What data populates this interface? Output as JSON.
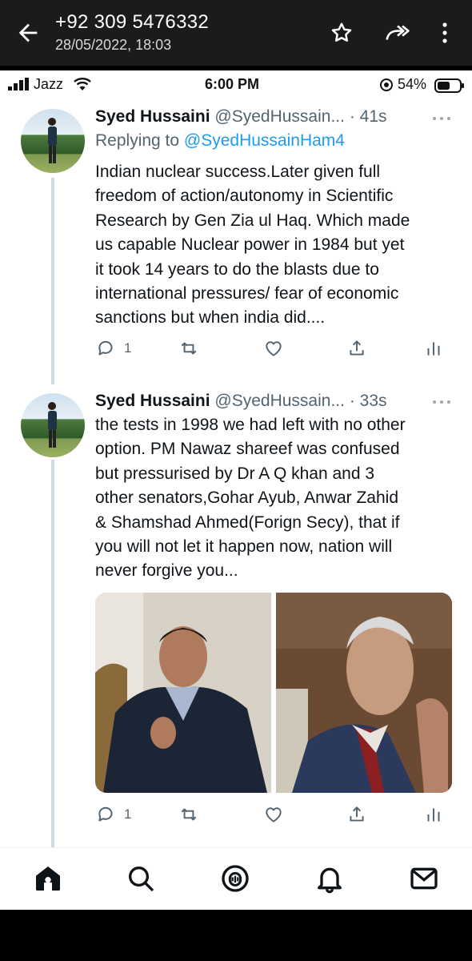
{
  "viewer": {
    "title": "+92 309 5476332",
    "subtitle": "28/05/2022, 18:03",
    "icons": [
      "back-arrow-icon",
      "star-icon",
      "forward-icon",
      "more-vert-icon"
    ]
  },
  "statusbar": {
    "carrier": "Jazz",
    "time": "6:00 PM",
    "battery": "54%"
  },
  "tweets": [
    {
      "name": "Syed Hussaini",
      "handle": "@SyedHussain...",
      "time": "· 41s",
      "replying_prefix": "Replying to ",
      "replying_to": "@SyedHussainHam4",
      "lines": [
        "Indian nuclear success.Later given full",
        "freedom of action/autonomy in Scientific",
        "Research by Gen Zia ul Haq. Which made",
        "us capable Nuclear power in 1984 but yet",
        "it took 14 years to do the blasts due to",
        "international pressures/ fear of economic",
        "sanctions but when india did...."
      ],
      "reply_count": "1"
    },
    {
      "name": "Syed Hussaini",
      "handle": "@SyedHussain...",
      "time": "· 33s",
      "lines": [
        "the tests in 1998 we had left with no other",
        "option. PM Nawaz shareef was confused",
        "but pressurised by Dr A Q khan and 3",
        "other senators,Gohar Ayub, Anwar Zahid",
        "& Shamshad Ahmed(Forign Secy), that if",
        "you will not let it happen now, nation will",
        "never forgive you..."
      ],
      "reply_count": "1"
    }
  ],
  "bottom_nav": [
    "home-icon",
    "search-icon",
    "spaces-icon",
    "notifications-icon",
    "messages-icon"
  ],
  "colors": {
    "link": "#1d9bf0",
    "secondary_text": "#536471",
    "primary_text": "#0f1419"
  }
}
